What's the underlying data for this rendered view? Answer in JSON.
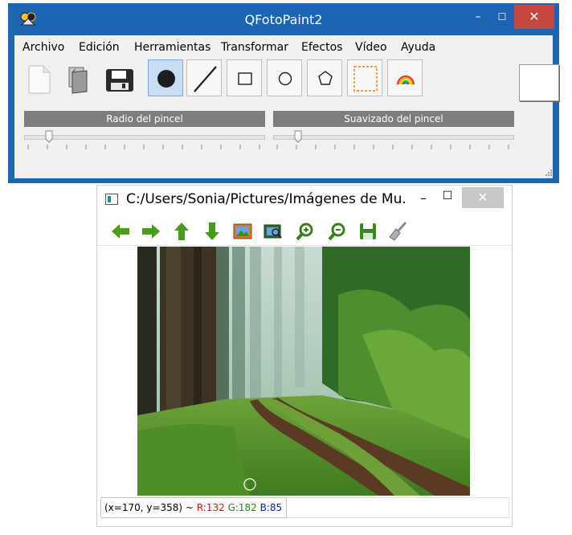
{
  "main_window": {
    "title": "QFotoPaint2",
    "close_glyph": "✕",
    "min_glyph": "–",
    "max_glyph": "☐"
  },
  "menu": [
    "Archivo",
    "Edición",
    "Herramientas",
    "Transformar",
    "Efectos",
    "Vídeo",
    "Ayuda"
  ],
  "toolbar": {
    "icons": [
      "new-document-icon",
      "open-icon",
      "save-icon",
      "brush-point-icon",
      "line-icon",
      "rectangle-icon",
      "ellipse-icon",
      "polygon-icon",
      "selection-icon",
      "rainbow-icon"
    ],
    "active": "brush-point-icon",
    "current_color": "#ffffff"
  },
  "sliders": [
    {
      "label": "Radio del pincel",
      "value": 0.1
    },
    {
      "label": "Suavizado del pincel",
      "value": 0.1
    }
  ],
  "viewer": {
    "title": "C:/Users/Sonia/Pictures/Imágenes de Mu...",
    "close_glyph": "✕",
    "min_glyph": "–",
    "max_glyph": "☐",
    "tools": [
      "arrow-left-icon",
      "arrow-right-icon",
      "arrow-up-icon",
      "arrow-down-icon",
      "picture-icon",
      "image-zoom-icon",
      "zoom-in-icon",
      "zoom-out-icon",
      "save-icon",
      "brush-icon"
    ],
    "status": {
      "coords": "(x=170, y=358) ~",
      "r": "R:132",
      "g": "G:182",
      "b": "B:85"
    }
  },
  "colors": {
    "accent_blue": "#1d64b5",
    "close_red": "#c7463e",
    "status_r": "#e01010",
    "status_g": "#208a20",
    "status_b": "#1010e0"
  }
}
